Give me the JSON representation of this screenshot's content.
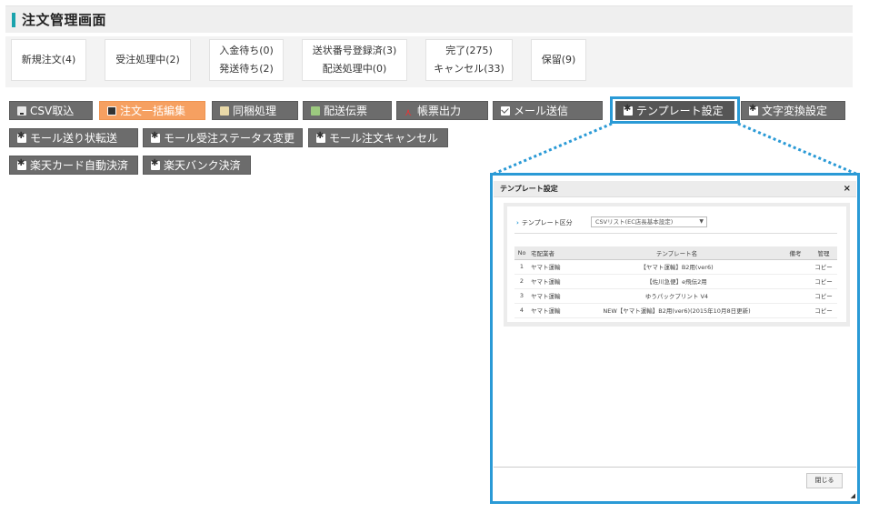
{
  "page": {
    "title": "注文管理画面"
  },
  "status_tabs": [
    {
      "lines": [
        "新規注文(4)"
      ]
    },
    {
      "lines": [
        "受注処理中(2)"
      ]
    },
    {
      "lines": [
        "入金待ち(0)",
        "発送待ち(2)"
      ]
    },
    {
      "lines": [
        "送状番号登録済(3)",
        "配送処理中(0)"
      ]
    },
    {
      "lines": [
        "完了(275)",
        "キャンセル(33)"
      ]
    },
    {
      "lines": [
        "保留(9)"
      ]
    }
  ],
  "toolbar": {
    "csv_import": "CSV取込",
    "bulk_edit": "注文一括編集",
    "bundle": "同梱処理",
    "delivery_slip": "配送伝票",
    "form_output": "帳票出力",
    "send_mail": "メール送信",
    "template_settings": "テンプレート設定",
    "char_convert": "文字変換設定",
    "mall_shipping_transfer": "モール送り状転送",
    "mall_status_change": "モール受注ステータス変更",
    "mall_cancel": "モール注文キャンセル",
    "rakuten_card": "楽天カード自動決済",
    "rakuten_bank": "楽天バンク決済"
  },
  "dialog": {
    "title": "テンプレート設定",
    "close_icon": "×",
    "filter_label": "テンプレート区分",
    "filter_value": "CSVリスト(EC店長基本設定)",
    "filter_arrow": "▼",
    "table": {
      "headers": {
        "no": "No",
        "carrier": "宅配業者",
        "name": "テンプレート名",
        "memo": "備考",
        "mgmt": "管理"
      },
      "rows": [
        {
          "no": "1",
          "carrier": "ヤマト運輸",
          "name": "【ヤマト運輸】B2用(ver6)",
          "memo": "",
          "mgmt": "コピー"
        },
        {
          "no": "2",
          "carrier": "ヤマト運輸",
          "name": "【佐川急便】e飛伝2用",
          "memo": "",
          "mgmt": "コピー"
        },
        {
          "no": "3",
          "carrier": "ヤマト運輸",
          "name": "ゆうパックプリント V4",
          "memo": "",
          "mgmt": "コピー"
        },
        {
          "no": "4",
          "carrier": "ヤマト運輸",
          "name": "NEW【ヤマト運輸】B2用(ver6)(2015年10月8日更新)",
          "memo": "",
          "mgmt": "コピー"
        }
      ]
    },
    "close_button": "閉じる"
  },
  "colors": {
    "accent": "#1aa3ad",
    "highlight": "#2a9ad6",
    "active_button": "#f6a061",
    "button": "#6c6c6c"
  }
}
